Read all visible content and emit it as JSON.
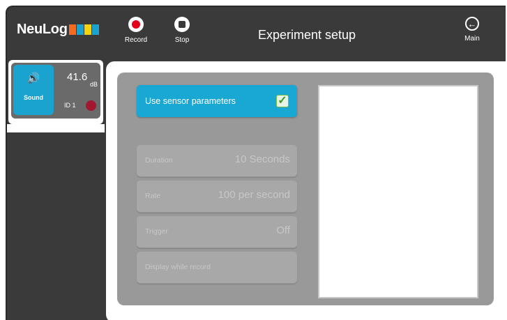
{
  "app": {
    "logo_text": "NeuLog",
    "logo_colors": [
      "#f26b21",
      "#1aa3cf",
      "#f5d40f",
      "#1aa3cf"
    ]
  },
  "toolbar": {
    "record_label": "Record",
    "stop_label": "Stop",
    "main_label": "Main",
    "title": "Experiment setup"
  },
  "sensor": {
    "name": "Sound",
    "value": "41.6",
    "unit": "dB",
    "id": "ID 1",
    "icon": "speaker-icon",
    "color": "#1aa3cf",
    "status_color": "#a3162f"
  },
  "setup": {
    "use_sensor_parameters": {
      "label": "Use sensor parameters",
      "checked": true
    },
    "params": [
      {
        "label": "Duration",
        "value": "10 Seconds"
      },
      {
        "label": "Rate",
        "value": "100 per second"
      },
      {
        "label": "Trigger",
        "value": "Off"
      },
      {
        "label": "Display while record",
        "value": ""
      }
    ]
  }
}
